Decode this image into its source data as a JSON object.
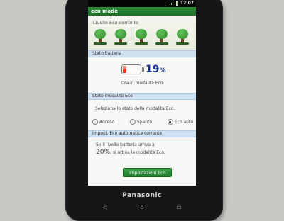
{
  "status_bar": {
    "time": "12:07"
  },
  "app": {
    "title": "eco mode"
  },
  "eco_level": {
    "label": "Livello Eco corrente",
    "trees": 5,
    "color": "#3aa040"
  },
  "battery_section": {
    "header": "Stato batteria",
    "percent": "19",
    "percent_unit": "%",
    "level_fraction": 0.19,
    "mode_text": "Ora in modalità Eco"
  },
  "eco_status_section": {
    "header": "Stato modalità Eco",
    "instruction": "Seleziona lo stato della modalità Eco.",
    "options": [
      {
        "label": "Acceso",
        "selected": false
      },
      {
        "label": "Spento",
        "selected": false
      },
      {
        "label": "Eco auto",
        "selected": true
      }
    ]
  },
  "auto_settings_section": {
    "header": "Impost. Eco automatica corrente",
    "line1": "Se il livello batteria arriva a",
    "threshold": "20%",
    "line2_suffix": ", si attiva la modalità Eco.",
    "button_label": "Impostazioni Eco"
  },
  "device": {
    "brand": "Panasonic"
  },
  "nav": {
    "back": "◁",
    "home": "⌂",
    "recent": "▭"
  }
}
